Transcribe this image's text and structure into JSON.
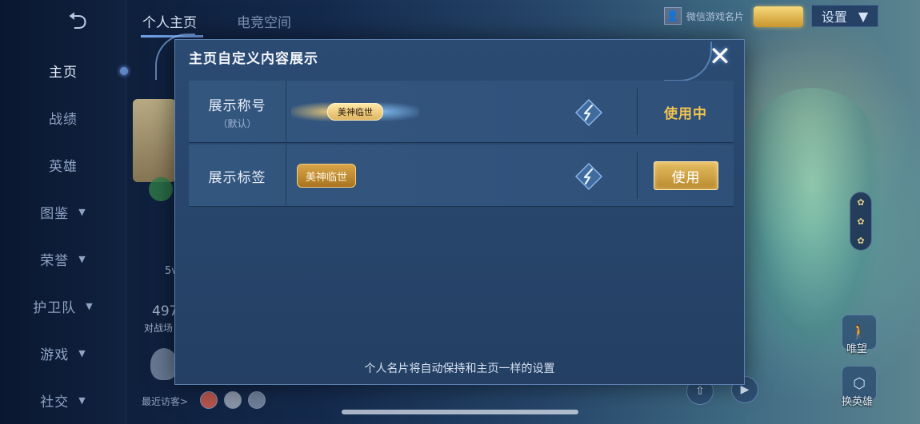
{
  "left_nav": {
    "items": [
      {
        "label": "主页",
        "active": true,
        "chevron": false
      },
      {
        "label": "战绩",
        "active": false,
        "chevron": false
      },
      {
        "label": "英雄",
        "active": false,
        "chevron": false
      },
      {
        "label": "图鉴",
        "active": false,
        "chevron": true
      },
      {
        "label": "荣誉",
        "active": false,
        "chevron": true
      },
      {
        "label": "护卫队",
        "active": false,
        "chevron": true
      },
      {
        "label": "游戏",
        "active": false,
        "chevron": true
      },
      {
        "label": "社交",
        "active": false,
        "chevron": true
      }
    ]
  },
  "header": {
    "tabs": [
      {
        "label": "个人主页",
        "active": true
      },
      {
        "label": "电竞空间",
        "active": false
      }
    ],
    "wechat_card_label": "微信游戏名片",
    "settings_label": "设置"
  },
  "background": {
    "stat_value": "497",
    "stat_label": "对战场",
    "stat_small": "5v",
    "recent_visitors_label": "最近访客>",
    "side_buttons": [
      {
        "label": "唯望"
      },
      {
        "label": "换英雄"
      }
    ]
  },
  "modal": {
    "title": "主页自定义内容展示",
    "rows": [
      {
        "label": "展示称号",
        "sublabel": "（默认）",
        "item_text": "美神临世",
        "status": "使用中"
      },
      {
        "label": "展示标签",
        "sublabel": "",
        "item_text": "美神临世",
        "action": "使用"
      }
    ],
    "footer": "个人名片将自动保持和主页一样的设置"
  },
  "icons": {
    "close": "close-icon",
    "swap": "swap-icon",
    "back": "back-arrow-icon",
    "settings_dropdown": "chevron-down-icon"
  },
  "colors": {
    "accent_gold": "#f3c34e",
    "button_gold": "#d6a849",
    "modal_bg": "#2b4b73"
  }
}
